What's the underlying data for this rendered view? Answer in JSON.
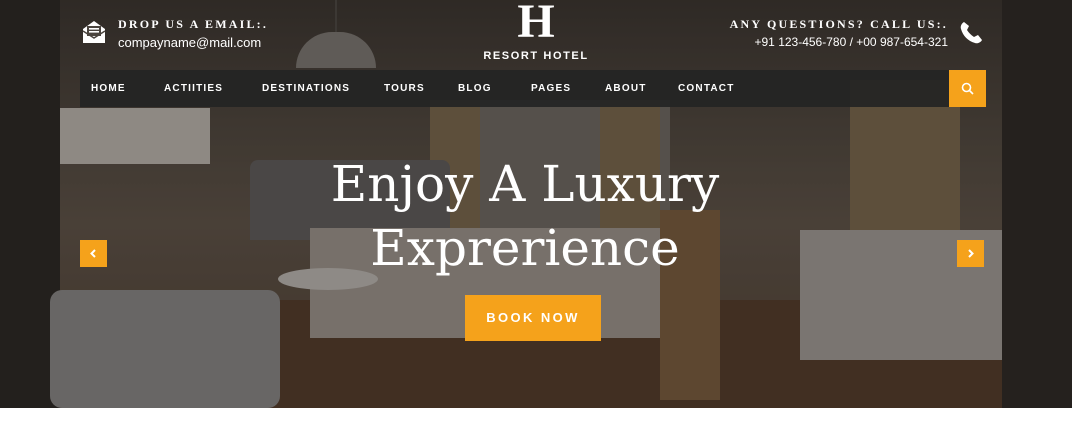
{
  "header": {
    "email_title": "DROP US A EMAIL:.",
    "email_value": "compayname@mail.com",
    "call_title": "ANY QUESTIONS? CALL US:.",
    "call_value": "+91 123-456-780 / +00 987-654-321",
    "logo_letter": "H",
    "logo_text": "RESORT HOTEL",
    "email_icon": "envelope-icon",
    "phone_icon": "phone-icon"
  },
  "nav": {
    "items": [
      "HOME",
      "ACTIITIES",
      "DESTINATIONS",
      "TOURS",
      "BLOG",
      "PAGES",
      "ABOUT",
      "CONTACT"
    ],
    "search_icon": "search-icon"
  },
  "hero": {
    "headline_line1": "Enjoy A Luxury",
    "headline_line2": "Exprerience",
    "button_label": "BOOK NOW",
    "prev_icon": "chevron-left-icon",
    "next_icon": "chevron-right-icon"
  },
  "colors": {
    "accent": "#f5a21b",
    "nav_background": "#242424",
    "text": "#ffffff"
  }
}
